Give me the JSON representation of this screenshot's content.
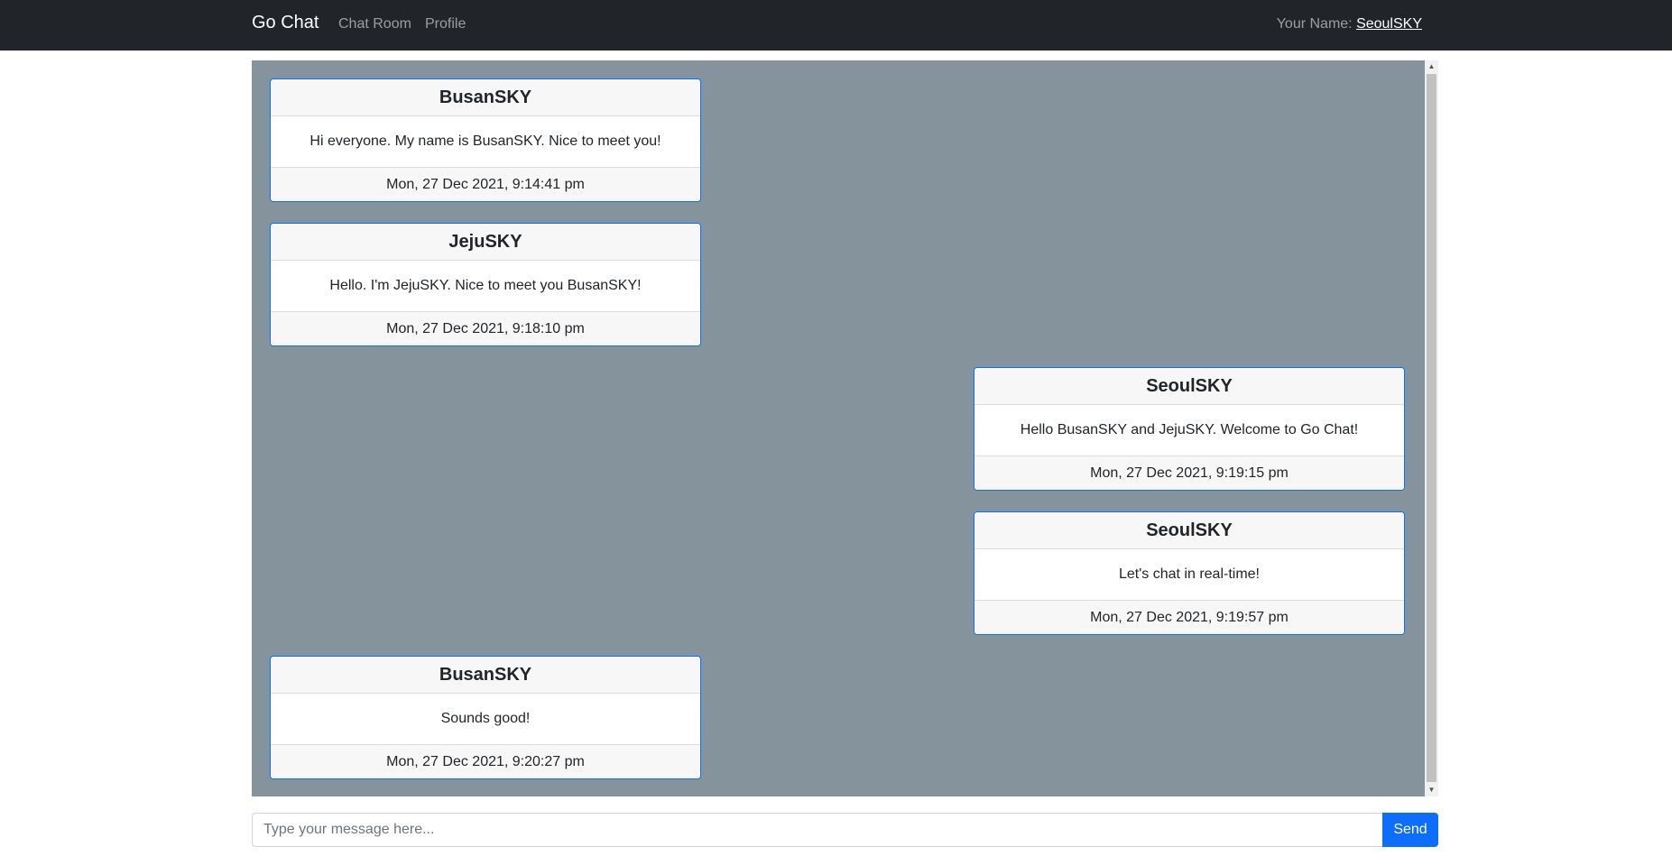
{
  "nav": {
    "brand": "Go Chat",
    "links": [
      "Chat Room",
      "Profile"
    ],
    "user_label": "Your Name: ",
    "user_name": "SeoulSKY"
  },
  "messages": [
    {
      "author": "BusanSKY",
      "text": "Hi everyone. My name is BusanSKY. Nice to meet you!",
      "time": "Mon, 27 Dec 2021, 9:14:41 pm",
      "side": "left"
    },
    {
      "author": "JejuSKY",
      "text": "Hello. I'm JejuSKY. Nice to meet you BusanSKY!",
      "time": "Mon, 27 Dec 2021, 9:18:10 pm",
      "side": "left"
    },
    {
      "author": "SeoulSKY",
      "text": "Hello BusanSKY and JejuSKY. Welcome to Go Chat!",
      "time": "Mon, 27 Dec 2021, 9:19:15 pm",
      "side": "right"
    },
    {
      "author": "SeoulSKY",
      "text": "Let's chat in real-time!",
      "time": "Mon, 27 Dec 2021, 9:19:57 pm",
      "side": "right"
    },
    {
      "author": "BusanSKY",
      "text": "Sounds good!",
      "time": "Mon, 27 Dec 2021, 9:20:27 pm",
      "side": "left"
    }
  ],
  "composer": {
    "placeholder": "Type your message here...",
    "value": "",
    "send_label": "Send"
  },
  "colors": {
    "navbar": "#212529",
    "chat_background": "#84939c",
    "accent": "#0d6efd"
  },
  "icons": {
    "scroll_up": "scroll-up-arrow-icon",
    "scroll_down": "scroll-down-arrow-icon"
  }
}
